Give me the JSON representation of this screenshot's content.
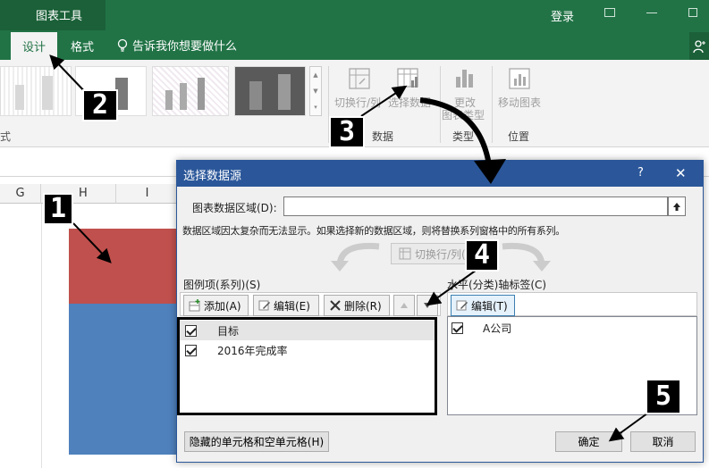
{
  "ribbon": {
    "context_tab": "图表工具",
    "tabs": [
      "设计",
      "格式"
    ],
    "tell_me": "告诉我你想要做什么",
    "login": "登录",
    "switch_row_col": "切换行/列",
    "select_data": "选择数据",
    "change_type_line1": "更改",
    "change_type_line2": "图表类型",
    "move_chart": "移动图表",
    "group_data": "数据",
    "group_type": "类型",
    "group_location": "位置",
    "left_cut": "式"
  },
  "sheet": {
    "columns": [
      "G",
      "H",
      "I"
    ]
  },
  "dialog": {
    "title": "选择数据源",
    "help": "?",
    "close": "✕",
    "range_label": "图表数据区域(D):",
    "range_value": "",
    "notice": "数据区域因太复杂而无法显示。如果选择新的数据区域，则将替换系列窗格中的所有系列。",
    "switch_btn": "切换行/列(W)",
    "legend_label": "图例项(系列)(S)",
    "add": "添加(A)",
    "edit": "编辑(E)",
    "delete": "删除(R)",
    "series": [
      {
        "name": "目标",
        "checked": true
      },
      {
        "name": "2016年完成率",
        "checked": true
      }
    ],
    "axis_label": "水平(分类)轴标签(C)",
    "axis_edit": "编辑(T)",
    "categories": [
      {
        "name": "A公司",
        "checked": true
      }
    ],
    "hidden_cells": "隐藏的单元格和空单元格(H)",
    "ok": "确定",
    "cancel": "取消"
  },
  "annotations": [
    "1",
    "2",
    "3",
    "4",
    "5"
  ],
  "colors": {
    "excel_green": "#217346",
    "dialog_title": "#2b579a",
    "chart_red": "#c0504d",
    "chart_blue": "#4f81bd"
  }
}
